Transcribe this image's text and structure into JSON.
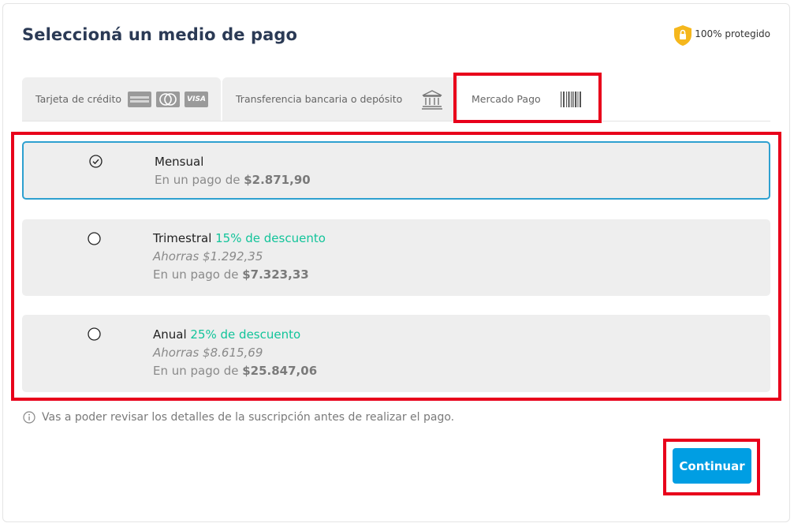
{
  "header": {
    "title": "Seleccioná un medio de pago",
    "protected_label": "100% protegido"
  },
  "tabs": [
    {
      "label": "Tarjeta de crédito",
      "icons": [
        "amex-icon",
        "mastercard-icon",
        "visa-icon"
      ],
      "logo_text": [
        "VISA"
      ]
    },
    {
      "label": "Transferencia bancaria o depósito",
      "icons": [
        "bank-icon"
      ]
    },
    {
      "label": "Mercado Pago",
      "icons": [
        "barcode-icon"
      ],
      "active": true
    }
  ],
  "plans": [
    {
      "name": "Mensual",
      "discount_value": "",
      "discount_text": "",
      "savings": "",
      "price_prefix": "En un pago de ",
      "price": "$2.871,90",
      "selected": true
    },
    {
      "name": "Trimestral",
      "discount_value": "15%",
      "discount_text": " de descuento",
      "savings": "Ahorras $1.292,35",
      "price_prefix": "En un pago de ",
      "price": "$7.323,33",
      "selected": false
    },
    {
      "name": "Anual",
      "discount_value": "25%",
      "discount_text": " de descuento",
      "savings": "Ahorras $8.615,69",
      "price_prefix": "En un pago de ",
      "price": "$25.847,06",
      "selected": false
    }
  ],
  "note": "Vas a poder revisar los detalles de la suscripción antes de realizar el pago.",
  "continue_label": "Continuar",
  "colors": {
    "accent": "#009ee3",
    "discount": "#12c49a",
    "highlight": "#e8001b",
    "selected_border": "#2ea0d0"
  }
}
